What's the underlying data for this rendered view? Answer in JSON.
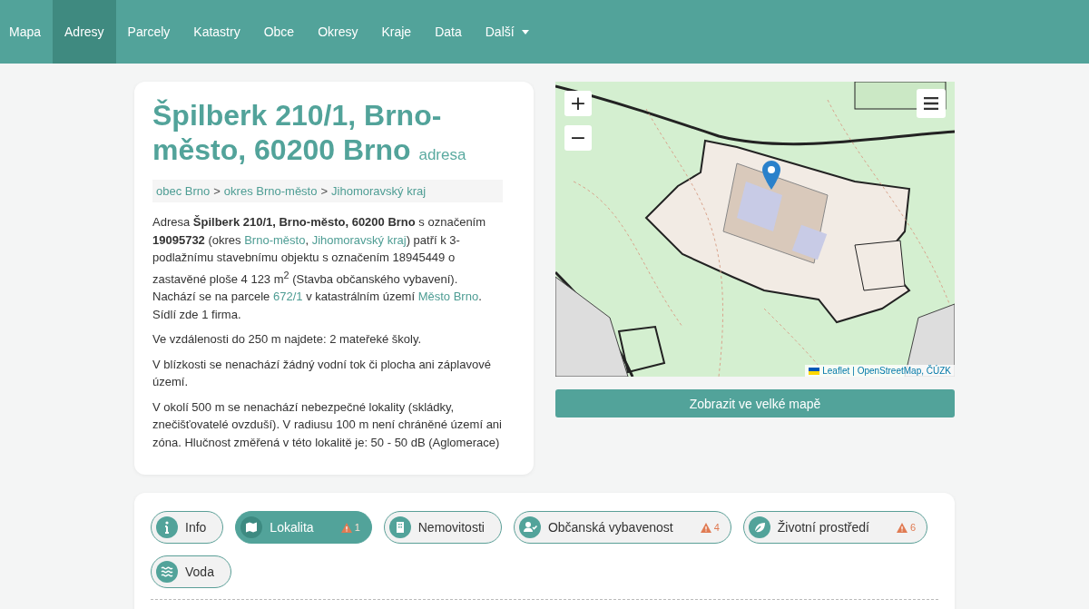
{
  "nav": {
    "items": [
      {
        "label": "Mapa",
        "selected": false
      },
      {
        "label": "Adresy",
        "selected": true
      },
      {
        "label": "Parcely",
        "selected": false
      },
      {
        "label": "Katastry",
        "selected": false
      },
      {
        "label": "Obce",
        "selected": false
      },
      {
        "label": "Okresy",
        "selected": false
      },
      {
        "label": "Kraje",
        "selected": false
      },
      {
        "label": "Data",
        "selected": false
      },
      {
        "label": "Další",
        "selected": false,
        "dropdown": true
      }
    ]
  },
  "address": {
    "title": "Špilberk 210/1, Brno-město, 60200 Brno",
    "type_label": "adresa",
    "breadcrumb": [
      {
        "kind": "link",
        "text": "obec Brno"
      },
      {
        "kind": "sep",
        "text": ">"
      },
      {
        "kind": "link",
        "text": "okres Brno-město"
      },
      {
        "kind": "sep",
        "text": ">"
      },
      {
        "kind": "link",
        "text": "Jihomoravský kraj"
      }
    ],
    "paragraphs": [
      [
        {
          "kind": "text",
          "text": "Adresa **Špilberk 210/1, Brno-město, 60200 Brno** s označením **19095732** (okres "
        },
        {
          "kind": "link",
          "text": "Brno-město"
        },
        {
          "kind": "text",
          "text": ", "
        },
        {
          "kind": "link",
          "text": "Jihomoravský kraj"
        },
        {
          "kind": "text",
          "text": ") patří k 3-podlažnímu stavebnímu objektu s označením 18945449 o zastavěné ploše 4 123 m$^{2}$ (Stavba občanského vybavení). Nachází se na parcele "
        },
        {
          "kind": "link",
          "text": "672/1"
        },
        {
          "kind": "text",
          "text": " v katastrálním území "
        },
        {
          "kind": "link",
          "text": "Město Brno"
        },
        {
          "kind": "text",
          "text": ". Sídlí zde 1 firma."
        }
      ],
      [
        {
          "kind": "text",
          "text": "Ve vzdálenosti do 250 m najdete: 2 mateřeké školy."
        }
      ],
      [
        {
          "kind": "text",
          "text": "V blízkosti se nenachází žádný vodní tok či plocha ani záplavové území."
        }
      ],
      [
        {
          "kind": "text",
          "text": "V okolí 500 m se nenachází nebezpečné lokality (skládky, znečišťovatelé ovzduší). V radiusu 100 m není chráněné území ani zóna. Hlučnost změřená v této lokalitě je: 50 - 50 dB (Aglomerace)"
        }
      ]
    ]
  },
  "map": {
    "zoom_in": "+",
    "zoom_out": "−",
    "attribution_link": "Leaflet",
    "attribution_text": "| OpenStreetMap, ČÚZK",
    "button": "Zobrazit ve velké mapě"
  },
  "tabs": [
    {
      "label": "Info",
      "selected": false
    },
    {
      "label": "Lokalita",
      "selected": true,
      "warnings": "1"
    },
    {
      "label": "Nemovitosti",
      "selected": false
    },
    {
      "label": "Občanská vybavenost",
      "selected": false,
      "warnings": "4"
    },
    {
      "label": "Životní prostředí",
      "selected": false,
      "warnings": "6"
    },
    {
      "label": "Voda",
      "selected": false
    }
  ]
}
